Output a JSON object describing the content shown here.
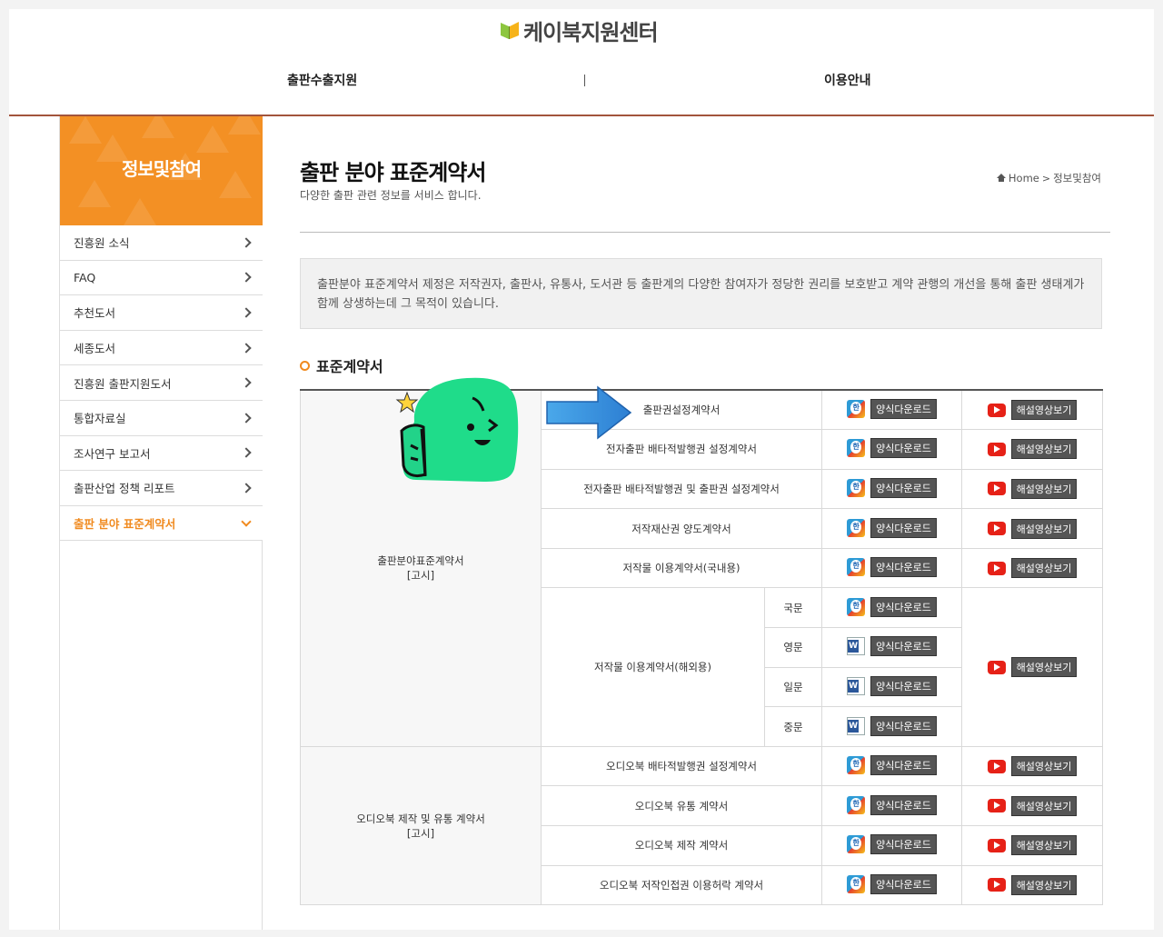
{
  "site": {
    "logo_text": "케이북지원센터"
  },
  "gnb": {
    "items": [
      "출판수출지원",
      "이용안내"
    ],
    "separator": "|"
  },
  "sidebar": {
    "title": "정보및참여",
    "items": [
      {
        "label": "진흥원 소식"
      },
      {
        "label": "FAQ"
      },
      {
        "label": "추천도서"
      },
      {
        "label": "세종도서"
      },
      {
        "label": "진흥원 출판지원도서"
      },
      {
        "label": "통합자료실"
      },
      {
        "label": "조사연구 보고서"
      },
      {
        "label": "출판산업 정책 리포트"
      },
      {
        "label": "출판 분야 표준계약서"
      }
    ],
    "active_index": 8
  },
  "page": {
    "title": "출판 분야 표준계약서",
    "subtitle": "다양한 출판 관련 정보를 서비스 합니다.",
    "breadcrumb": {
      "home": "Home",
      "current": "정보및참여"
    },
    "description": "출판분야 표준계약서 제정은 저작권자, 출판사, 유통사, 도서관 등 출판계의 다양한 참여자가 정당한 권리를 보호받고 계약 관행의 개선을 통해 출판 생태계가 함께 상생하는데 그 목적이 있습니다.",
    "section_title": "표준계약서"
  },
  "buttons": {
    "download": "양식다운로드",
    "video": "해설영상보기"
  },
  "table": {
    "group1": {
      "label": "출판분야표준계약서",
      "tag": "[고시]"
    },
    "group2": {
      "label": "오디오북 제작 및 유통 계약서",
      "tag": "[고시]"
    },
    "rows": [
      "출판권설정계약서",
      "전자출판 배타적발행권 설정계약서",
      "전자출판 배타적발행권 및 출판권 설정계약서",
      "저작재산권 양도계약서",
      "저작물 이용계약서(국내용)",
      "저작물 이용계약서(해외용)",
      "오디오북 배타적발행권 설정계약서",
      "오디오북 유통 계약서",
      "오디오북 제작 계약서",
      "오디오북 저작인접권 이용허락 계약서"
    ],
    "languages": [
      "국문",
      "영문",
      "일문",
      "중문"
    ]
  },
  "icons": {
    "hwp": "hwp-file-icon",
    "word": "word-file-icon",
    "video": "youtube-icon"
  },
  "colors": {
    "accent": "#f39024",
    "header_line": "#a2543c",
    "button": "#555555"
  }
}
